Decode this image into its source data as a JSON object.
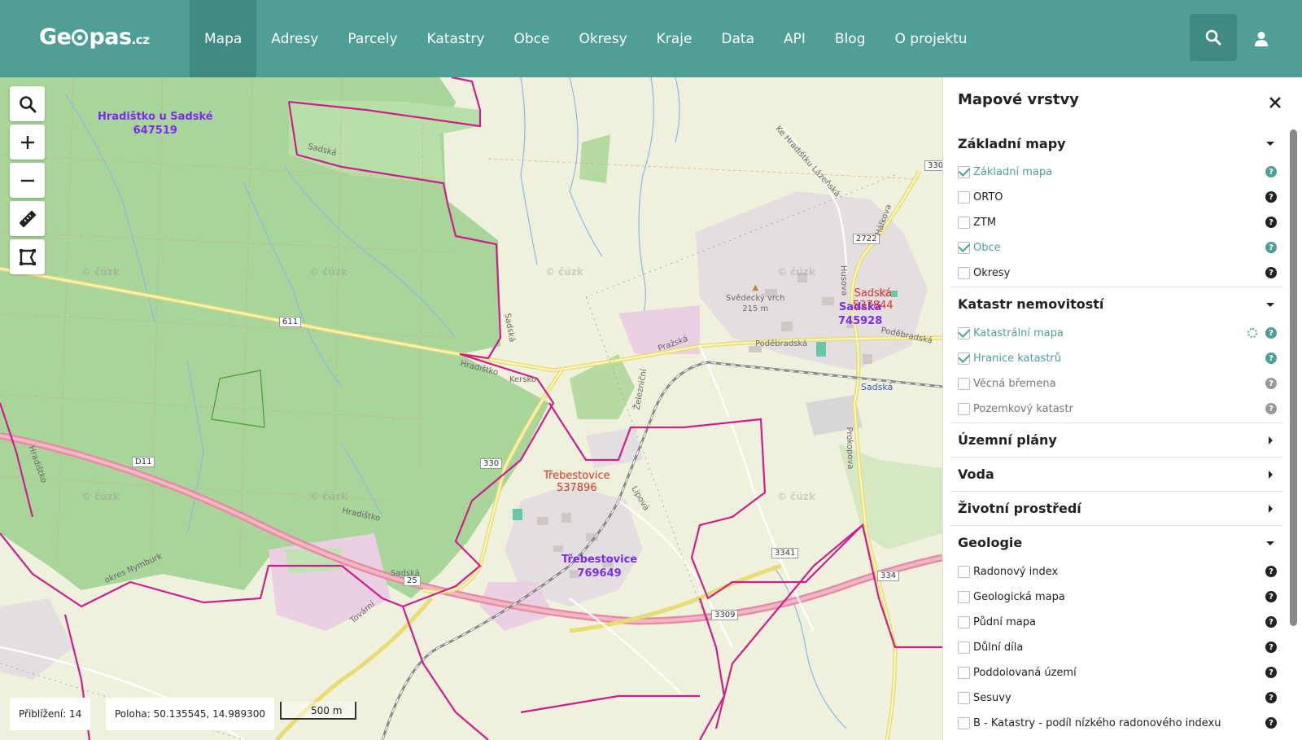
{
  "header": {
    "logo_main": "Ge",
    "logo_rest": "pas",
    "logo_tld": ".cz",
    "nav": [
      "Mapa",
      "Adresy",
      "Parcely",
      "Katastry",
      "Obce",
      "Okresy",
      "Kraje",
      "Data",
      "API",
      "Blog",
      "O projektu"
    ],
    "active_nav": "Mapa",
    "search_icon": "search-icon",
    "user_icon": "user-icon"
  },
  "map": {
    "tools": [
      "search-icon",
      "zoom-in-icon",
      "zoom-out-icon",
      "ruler-icon",
      "polygon-icon"
    ],
    "cadastral_labels": [
      {
        "name": "Hradištko u Sadské",
        "code": "647519"
      },
      {
        "name": "Třebestovice",
        "code": "769649"
      },
      {
        "name": "Sadská",
        "code": "745928"
      }
    ],
    "municipality_labels": [
      {
        "name": "Třebestovice",
        "code": "537896"
      },
      {
        "name": "Sadská",
        "code": "537844"
      }
    ],
    "road_numbers": [
      "611",
      "330",
      "D11",
      "2722",
      "3341",
      "3309",
      "330",
      "334",
      "25"
    ],
    "place_names": {
      "peak_name": "Svědecký vrch",
      "peak_elevation": "215 m",
      "station": "Sadská",
      "streets": [
        "Pražská",
        "Poděbradská",
        "Sadská",
        "Kersko",
        "Hradištko",
        "Lipová",
        "Tovární",
        "Prokopova",
        "Železniční",
        "Ke Hradištku Lázeňská",
        "okres Nymburk",
        "Hálkova",
        "Husova"
      ]
    },
    "watermark": "© čúzk",
    "zoom_label": "Přiblížení: 14",
    "position_label": "Poloha: 50.135545, 14.989300",
    "scale_label": "500 m"
  },
  "panel": {
    "title": "Mapové vrstvy",
    "sections": [
      {
        "label": "Základní mapy",
        "expanded": true,
        "layers": [
          {
            "label": "Základní mapa",
            "checked": true
          },
          {
            "label": "ORTO",
            "checked": false
          },
          {
            "label": "ZTM",
            "checked": false
          },
          {
            "label": "Obce",
            "checked": true
          },
          {
            "label": "Okresy",
            "checked": false
          }
        ]
      },
      {
        "label": "Katastr nemovitostí",
        "expanded": true,
        "layers": [
          {
            "label": "Katastrální mapa",
            "checked": true,
            "loading": true
          },
          {
            "label": "Hranice katastrů",
            "checked": true
          },
          {
            "label": "Věcná břemena",
            "checked": false
          },
          {
            "label": "Pozemkový katastr",
            "checked": false
          }
        ]
      },
      {
        "label": "Územní plány",
        "expanded": false,
        "layers": []
      },
      {
        "label": "Voda",
        "expanded": false,
        "layers": []
      },
      {
        "label": "Životní prostředí",
        "expanded": false,
        "layers": []
      },
      {
        "label": "Geologie",
        "expanded": true,
        "layers": [
          {
            "label": "Radonový index",
            "checked": false
          },
          {
            "label": "Geologická mapa",
            "checked": false
          },
          {
            "label": "Půdní mapa",
            "checked": false
          },
          {
            "label": "Důlní díla",
            "checked": false
          },
          {
            "label": "Poddolovaná území",
            "checked": false
          },
          {
            "label": "Sesuvy",
            "checked": false
          },
          {
            "label": "B - Katastry - podíl nízkého radonového indexu",
            "checked": false
          }
        ]
      }
    ],
    "help_glyph": "?"
  },
  "colors": {
    "header": "#4f9f96",
    "header_active": "#3f8b82",
    "forest": "#a9d59b",
    "boundary": "#cc1f8c",
    "motorway": "#e58da3",
    "cadastral_text": "#7a2cf0",
    "municipality_text": "#e0302a"
  }
}
